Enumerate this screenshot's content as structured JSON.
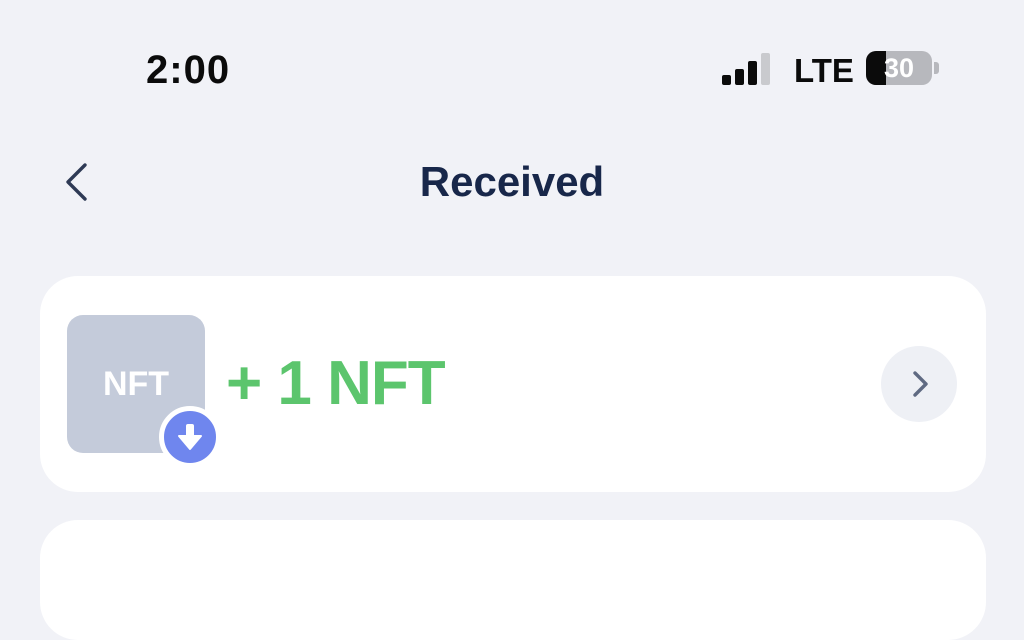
{
  "status_bar": {
    "time": "2:00",
    "network": "LTE",
    "battery_level": "30",
    "signal_bars_active": 3,
    "signal_bars_total": 4
  },
  "nav": {
    "title": "Received",
    "back_icon": "chevron-left-icon"
  },
  "transaction": {
    "thumbnail_label": "NFT",
    "amount": "+ 1 NFT",
    "badge_icon": "arrow-down-icon",
    "detail_icon": "chevron-right-icon",
    "amount_color": "#5CC56D",
    "badge_color": "#6F86EE"
  },
  "colors": {
    "background": "#F1F2F7",
    "title": "#18274A"
  }
}
